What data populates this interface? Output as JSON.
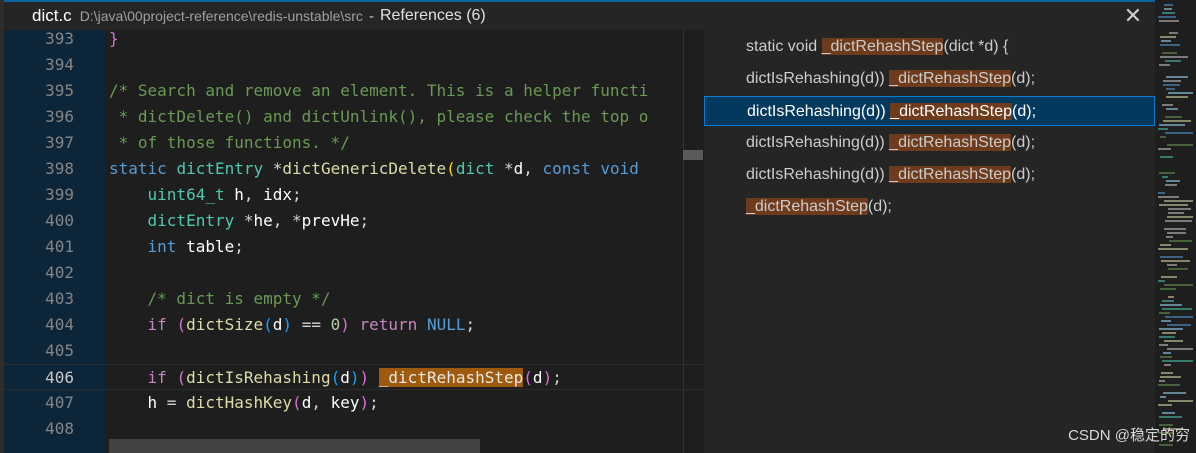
{
  "peek_header": {
    "file_name": "dict.c",
    "file_path": "D:\\java\\00project-reference\\redis-unstable\\src",
    "separator": "-",
    "references_title": "References (6)",
    "close_glyph": "✕"
  },
  "editor": {
    "lines": [
      {
        "num": "393",
        "tokens": [
          {
            "t": "}",
            "c": "b2"
          }
        ]
      },
      {
        "num": "394",
        "tokens": []
      },
      {
        "num": "395",
        "tokens": [
          {
            "t": "/* Search and remove an element. This is a helper functi",
            "c": "cm"
          }
        ]
      },
      {
        "num": "396",
        "tokens": [
          {
            "t": " * dictDelete() and dictUnlink(), please check the top o",
            "c": "cm"
          }
        ]
      },
      {
        "num": "397",
        "tokens": [
          {
            "t": " * of those functions. */",
            "c": "cm"
          }
        ]
      },
      {
        "num": "398",
        "tokens": [
          {
            "t": "static",
            "c": "kw"
          },
          {
            "t": " "
          },
          {
            "t": "dictEntry",
            "c": "ty"
          },
          {
            "t": " *"
          },
          {
            "t": "dictGenericDelete",
            "c": "fn"
          },
          {
            "t": "(",
            "c": "b1"
          },
          {
            "t": "dict",
            "c": "ty"
          },
          {
            "t": " *"
          },
          {
            "t": "d",
            "c": "id"
          },
          {
            "t": ", "
          },
          {
            "t": "const",
            "c": "kw"
          },
          {
            "t": " "
          },
          {
            "t": "void",
            "c": "kw"
          }
        ]
      },
      {
        "num": "399",
        "tokens": [
          {
            "t": "    "
          },
          {
            "t": "uint64_t",
            "c": "ty"
          },
          {
            "t": " "
          },
          {
            "t": "h",
            "c": "id"
          },
          {
            "t": ", "
          },
          {
            "t": "idx",
            "c": "id"
          },
          {
            "t": ";"
          }
        ]
      },
      {
        "num": "400",
        "tokens": [
          {
            "t": "    "
          },
          {
            "t": "dictEntry",
            "c": "ty"
          },
          {
            "t": " *"
          },
          {
            "t": "he",
            "c": "id"
          },
          {
            "t": ", *"
          },
          {
            "t": "prevHe",
            "c": "id"
          },
          {
            "t": ";"
          }
        ]
      },
      {
        "num": "401",
        "tokens": [
          {
            "t": "    "
          },
          {
            "t": "int",
            "c": "kw"
          },
          {
            "t": " "
          },
          {
            "t": "table",
            "c": "id"
          },
          {
            "t": ";"
          }
        ]
      },
      {
        "num": "402",
        "tokens": []
      },
      {
        "num": "403",
        "tokens": [
          {
            "t": "    "
          },
          {
            "t": "/* dict is empty */",
            "c": "cm"
          }
        ]
      },
      {
        "num": "404",
        "tokens": [
          {
            "t": "    "
          },
          {
            "t": "if",
            "c": "ctl"
          },
          {
            "t": " "
          },
          {
            "t": "(",
            "c": "b2"
          },
          {
            "t": "dictSize",
            "c": "fn"
          },
          {
            "t": "(",
            "c": "b3"
          },
          {
            "t": "d",
            "c": "id"
          },
          {
            "t": ")",
            "c": "b3"
          },
          {
            "t": " == "
          },
          {
            "t": "0",
            "c": "num"
          },
          {
            "t": ")",
            "c": "b2"
          },
          {
            "t": " "
          },
          {
            "t": "return",
            "c": "ctl"
          },
          {
            "t": " "
          },
          {
            "t": "NULL",
            "c": "kw"
          },
          {
            "t": ";"
          }
        ]
      },
      {
        "num": "405",
        "tokens": []
      },
      {
        "num": "406",
        "current": true,
        "tokens": [
          {
            "t": "    "
          },
          {
            "t": "if",
            "c": "ctl"
          },
          {
            "t": " "
          },
          {
            "t": "(",
            "c": "b2"
          },
          {
            "t": "dictIsRehashing",
            "c": "fn"
          },
          {
            "t": "(",
            "c": "b3"
          },
          {
            "t": "d",
            "c": "id"
          },
          {
            "t": ")",
            "c": "b3"
          },
          {
            "t": ")",
            "c": "b2"
          },
          {
            "t": " "
          },
          {
            "t": "_dictRehashStep",
            "c": "hl"
          },
          {
            "t": "(",
            "c": "b2"
          },
          {
            "t": "d",
            "c": "id"
          },
          {
            "t": ")",
            "c": "b2"
          },
          {
            "t": ";"
          }
        ]
      },
      {
        "num": "407",
        "tokens": [
          {
            "t": "    "
          },
          {
            "t": "h",
            "c": "id"
          },
          {
            "t": " = "
          },
          {
            "t": "dictHashKey",
            "c": "fn"
          },
          {
            "t": "(",
            "c": "b2"
          },
          {
            "t": "d",
            "c": "id"
          },
          {
            "t": ", "
          },
          {
            "t": "key",
            "c": "id"
          },
          {
            "t": ")",
            "c": "b2"
          },
          {
            "t": ";"
          }
        ]
      },
      {
        "num": "408",
        "tokens": []
      }
    ]
  },
  "references": [
    {
      "pre": "static void ",
      "match": "_dictRehashStep",
      "post": "(dict *d) {",
      "selected": false
    },
    {
      "pre": "dictIsRehashing(d)) ",
      "match": "_dictRehashStep",
      "post": "(d);",
      "selected": false
    },
    {
      "pre": "dictIsRehashing(d)) ",
      "match": "_dictRehashStep",
      "post": "(d);",
      "selected": true
    },
    {
      "pre": "dictIsRehashing(d)) ",
      "match": "_dictRehashStep",
      "post": "(d);",
      "selected": false
    },
    {
      "pre": "dictIsRehashing(d)) ",
      "match": "_dictRehashStep",
      "post": "(d);",
      "selected": false
    },
    {
      "pre": "",
      "match": "_dictRehashStep",
      "post": "(d);",
      "selected": false
    }
  ],
  "watermark": "CSDN @稳定的穷"
}
